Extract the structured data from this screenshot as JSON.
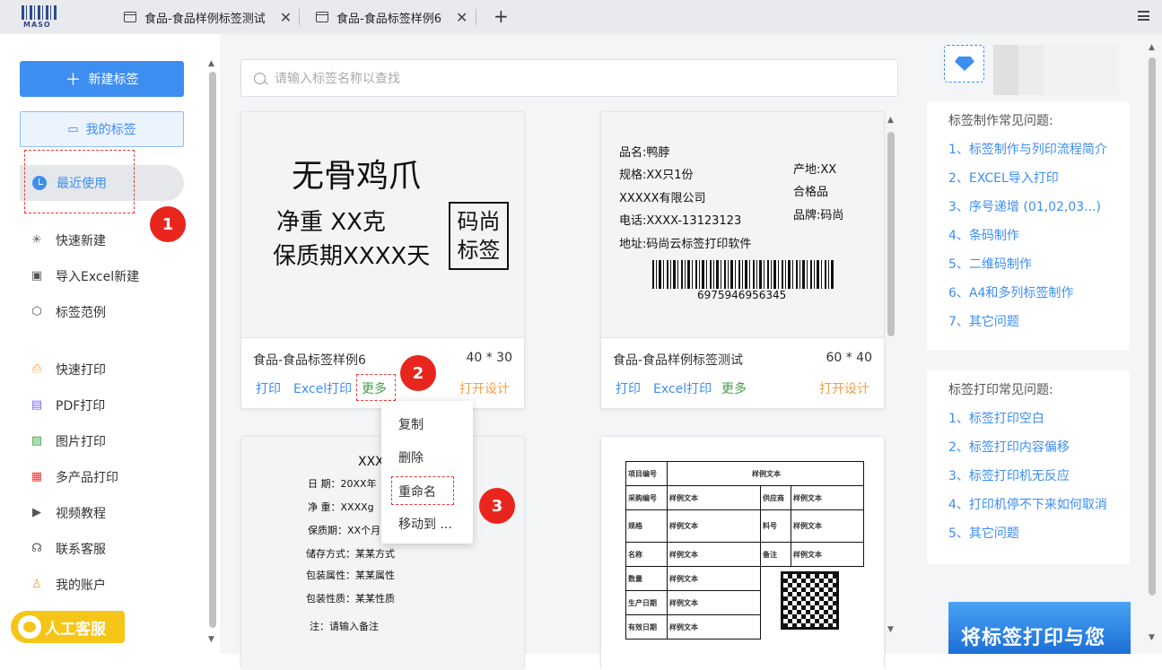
{
  "brand": {
    "logo_text": "MASO"
  },
  "tabs": [
    {
      "label": "食品-食品样例标签测试"
    },
    {
      "label": "食品-食品标签样例6"
    }
  ],
  "tab_new": "+",
  "sidebar": {
    "new_label": "新建标签",
    "my_labels": "我的标签",
    "recent": "最近使用",
    "items": [
      {
        "label": "快速新建",
        "icon": "sparkle-icon"
      },
      {
        "label": "导入Excel新建",
        "icon": "excel-icon"
      },
      {
        "label": "标签范例",
        "icon": "cube-icon"
      },
      {
        "label": "快速打印",
        "icon": "printer-icon"
      },
      {
        "label": "PDF打印",
        "icon": "pdf-icon"
      },
      {
        "label": "图片打印",
        "icon": "image-icon"
      },
      {
        "label": "多产品打印",
        "icon": "multi-product-icon"
      },
      {
        "label": "视频教程",
        "icon": "video-icon"
      },
      {
        "label": "联系客服",
        "icon": "headset-icon"
      },
      {
        "label": "我的账户",
        "icon": "user-icon"
      }
    ],
    "help": "人工客服"
  },
  "annotations": {
    "b1": "1",
    "b2": "2",
    "b3": "3"
  },
  "search": {
    "placeholder": "请输入标签名称以查找"
  },
  "cards": [
    {
      "name": "食品-食品标签样例6",
      "size": "40 * 30",
      "preview": {
        "title": "无骨鸡爪",
        "line1": "净重 XX克",
        "line2": "保质期XXXX天",
        "stamp1": "码尚",
        "stamp2": "标签"
      }
    },
    {
      "name": "食品-食品样例标签测试",
      "size": "60 * 40",
      "preview": {
        "l1": "品名:鸭脖",
        "l2": "规格:XX只1份",
        "l3": "XXXXX有限公司",
        "l4": "电话:XXXX-13123123",
        "l5": "地址:码尚云标签打印软件",
        "r1": "产地:XX",
        "r2": "合格品",
        "r3": "品牌:码尚",
        "barcode": "6975946956345"
      }
    },
    {
      "preview": {
        "title": "XXX",
        "l1": "日  期：20XX年",
        "l2": "净  重：XXXXg",
        "l3": "保质期：XX个月",
        "l4": "储存方式：某某方式",
        "l5": "包装属性：某某属性",
        "l6": "包装性质：某某性质",
        "l7": "注：请输入备注"
      }
    },
    {
      "preview": {
        "rows": [
          [
            "项目编号",
            "样例文本",
            "",
            ""
          ],
          [
            "采购编号",
            "样例文本",
            "供应商",
            "样例文本"
          ],
          [
            "规格",
            "样例文本",
            "料号",
            "样例文本"
          ],
          [
            "名称",
            "样例文本",
            "备注",
            "样例文本"
          ],
          [
            "数量",
            "样例文本",
            "",
            ""
          ],
          [
            "生产日期",
            "样例文本",
            "",
            ""
          ],
          [
            "有效日期",
            "样例文本",
            "",
            ""
          ]
        ]
      }
    }
  ],
  "actions": {
    "print": "打印",
    "excel_print": "Excel打印",
    "more": "更多",
    "open_design": "打开设计"
  },
  "context_menu": [
    "复制",
    "删除",
    "重命名",
    "移动到 ..."
  ],
  "faq1": {
    "title": "标签制作常见问题:",
    "items": [
      "1、标签制作与列印流程简介",
      "2、EXCEL导入打印",
      "3、序号递增 (01,02,03...)",
      "4、条码制作",
      "5、二维码制作",
      "6、A4和多列标签制作",
      "7、其它问题"
    ]
  },
  "faq2": {
    "title": "标签打印常见问题:",
    "items": [
      "1、标签打印空白",
      "2、标签打印内容偏移",
      "3、标签打印机无反应",
      "4、打印机停不下来如何取消",
      "5、其它问题"
    ]
  },
  "banner": {
    "text": "将标签打印与您"
  },
  "colors": {
    "accent": "#3d8ef0",
    "annotation": "#e8261d",
    "more": "#43a047",
    "design": "#f0a04b"
  }
}
